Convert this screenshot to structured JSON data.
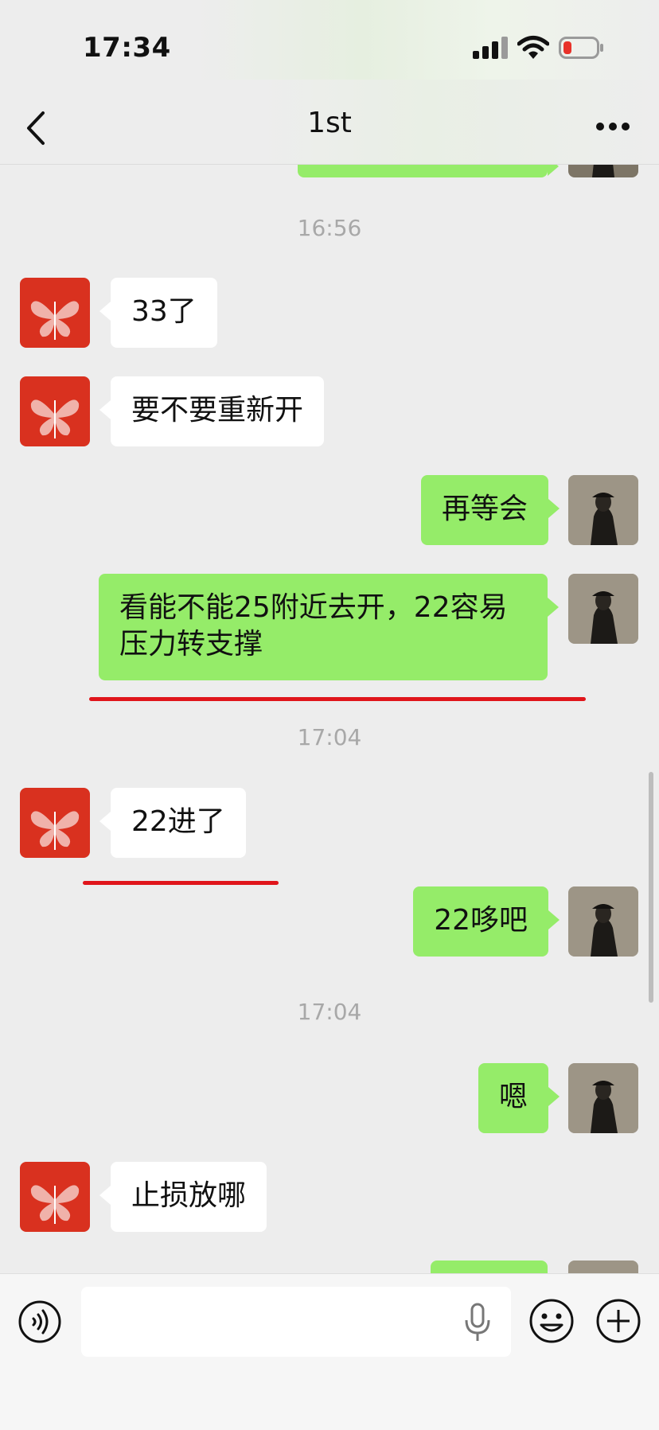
{
  "status_bar": {
    "time": "17:34",
    "icons": [
      "signal-icon",
      "wifi-icon",
      "battery-low-icon"
    ]
  },
  "nav": {
    "title": "1st",
    "back_icon": "chevron-left-icon",
    "more_icon": "more-dots-icon"
  },
  "colors": {
    "outgoing_bubble": "#95ec69",
    "incoming_bubble": "#ffffff",
    "background": "#ededed",
    "highlight_underline": "#e0151b"
  },
  "chat": {
    "timestamps": [
      "16:56",
      "17:04",
      "17:04"
    ],
    "messages": [
      {
        "side": "in",
        "text": "33了"
      },
      {
        "side": "in",
        "text": "要不要重新开"
      },
      {
        "side": "out",
        "text": "再等会"
      },
      {
        "side": "out",
        "text": "看能不能25附近去开，22容易压力转支撑"
      },
      {
        "side": "in",
        "text": "22进了"
      },
      {
        "side": "out",
        "text": "22哆吧"
      },
      {
        "side": "out",
        "text": "嗯"
      },
      {
        "side": "in",
        "text": "止损放哪"
      }
    ]
  },
  "input_bar": {
    "voice_icon": "voice-mode-icon",
    "mic_icon": "microphone-icon",
    "emoji_icon": "emoji-icon",
    "plus_icon": "plus-icon"
  }
}
